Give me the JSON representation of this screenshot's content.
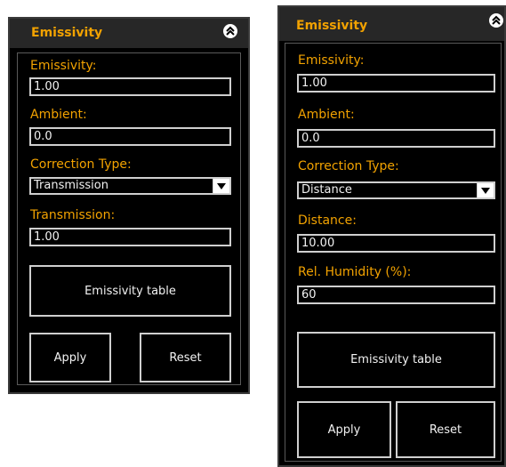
{
  "left_panel": {
    "title": "Emissivity",
    "emissivity": {
      "label": "Emissivity:",
      "value": "1.00"
    },
    "ambient": {
      "label": "Ambient:",
      "value": "0.0"
    },
    "correction_type": {
      "label": "Correction Type:",
      "value": "Transmission"
    },
    "transmission": {
      "label": "Transmission:",
      "value": "1.00"
    },
    "emissivity_table_label": "Emissivity table",
    "apply_label": "Apply",
    "reset_label": "Reset"
  },
  "right_panel": {
    "title": "Emissivity",
    "emissivity": {
      "label": "Emissivity:",
      "value": "1.00"
    },
    "ambient": {
      "label": "Ambient:",
      "value": "0.0"
    },
    "correction_type": {
      "label": "Correction Type:",
      "value": "Distance"
    },
    "distance": {
      "label": "Distance:",
      "value": "10.00"
    },
    "humidity": {
      "label": "Rel. Humidity (%):",
      "value": "60"
    },
    "emissivity_table_label": "Emissivity table",
    "apply_label": "Apply",
    "reset_label": "Reset"
  },
  "colors": {
    "accent": "#f2a200",
    "background": "#000000",
    "header": "#272727",
    "border": "#cfcfcf"
  },
  "icons": {
    "collapse": "double-chevron-up-icon",
    "dropdown": "chevron-down-icon"
  }
}
